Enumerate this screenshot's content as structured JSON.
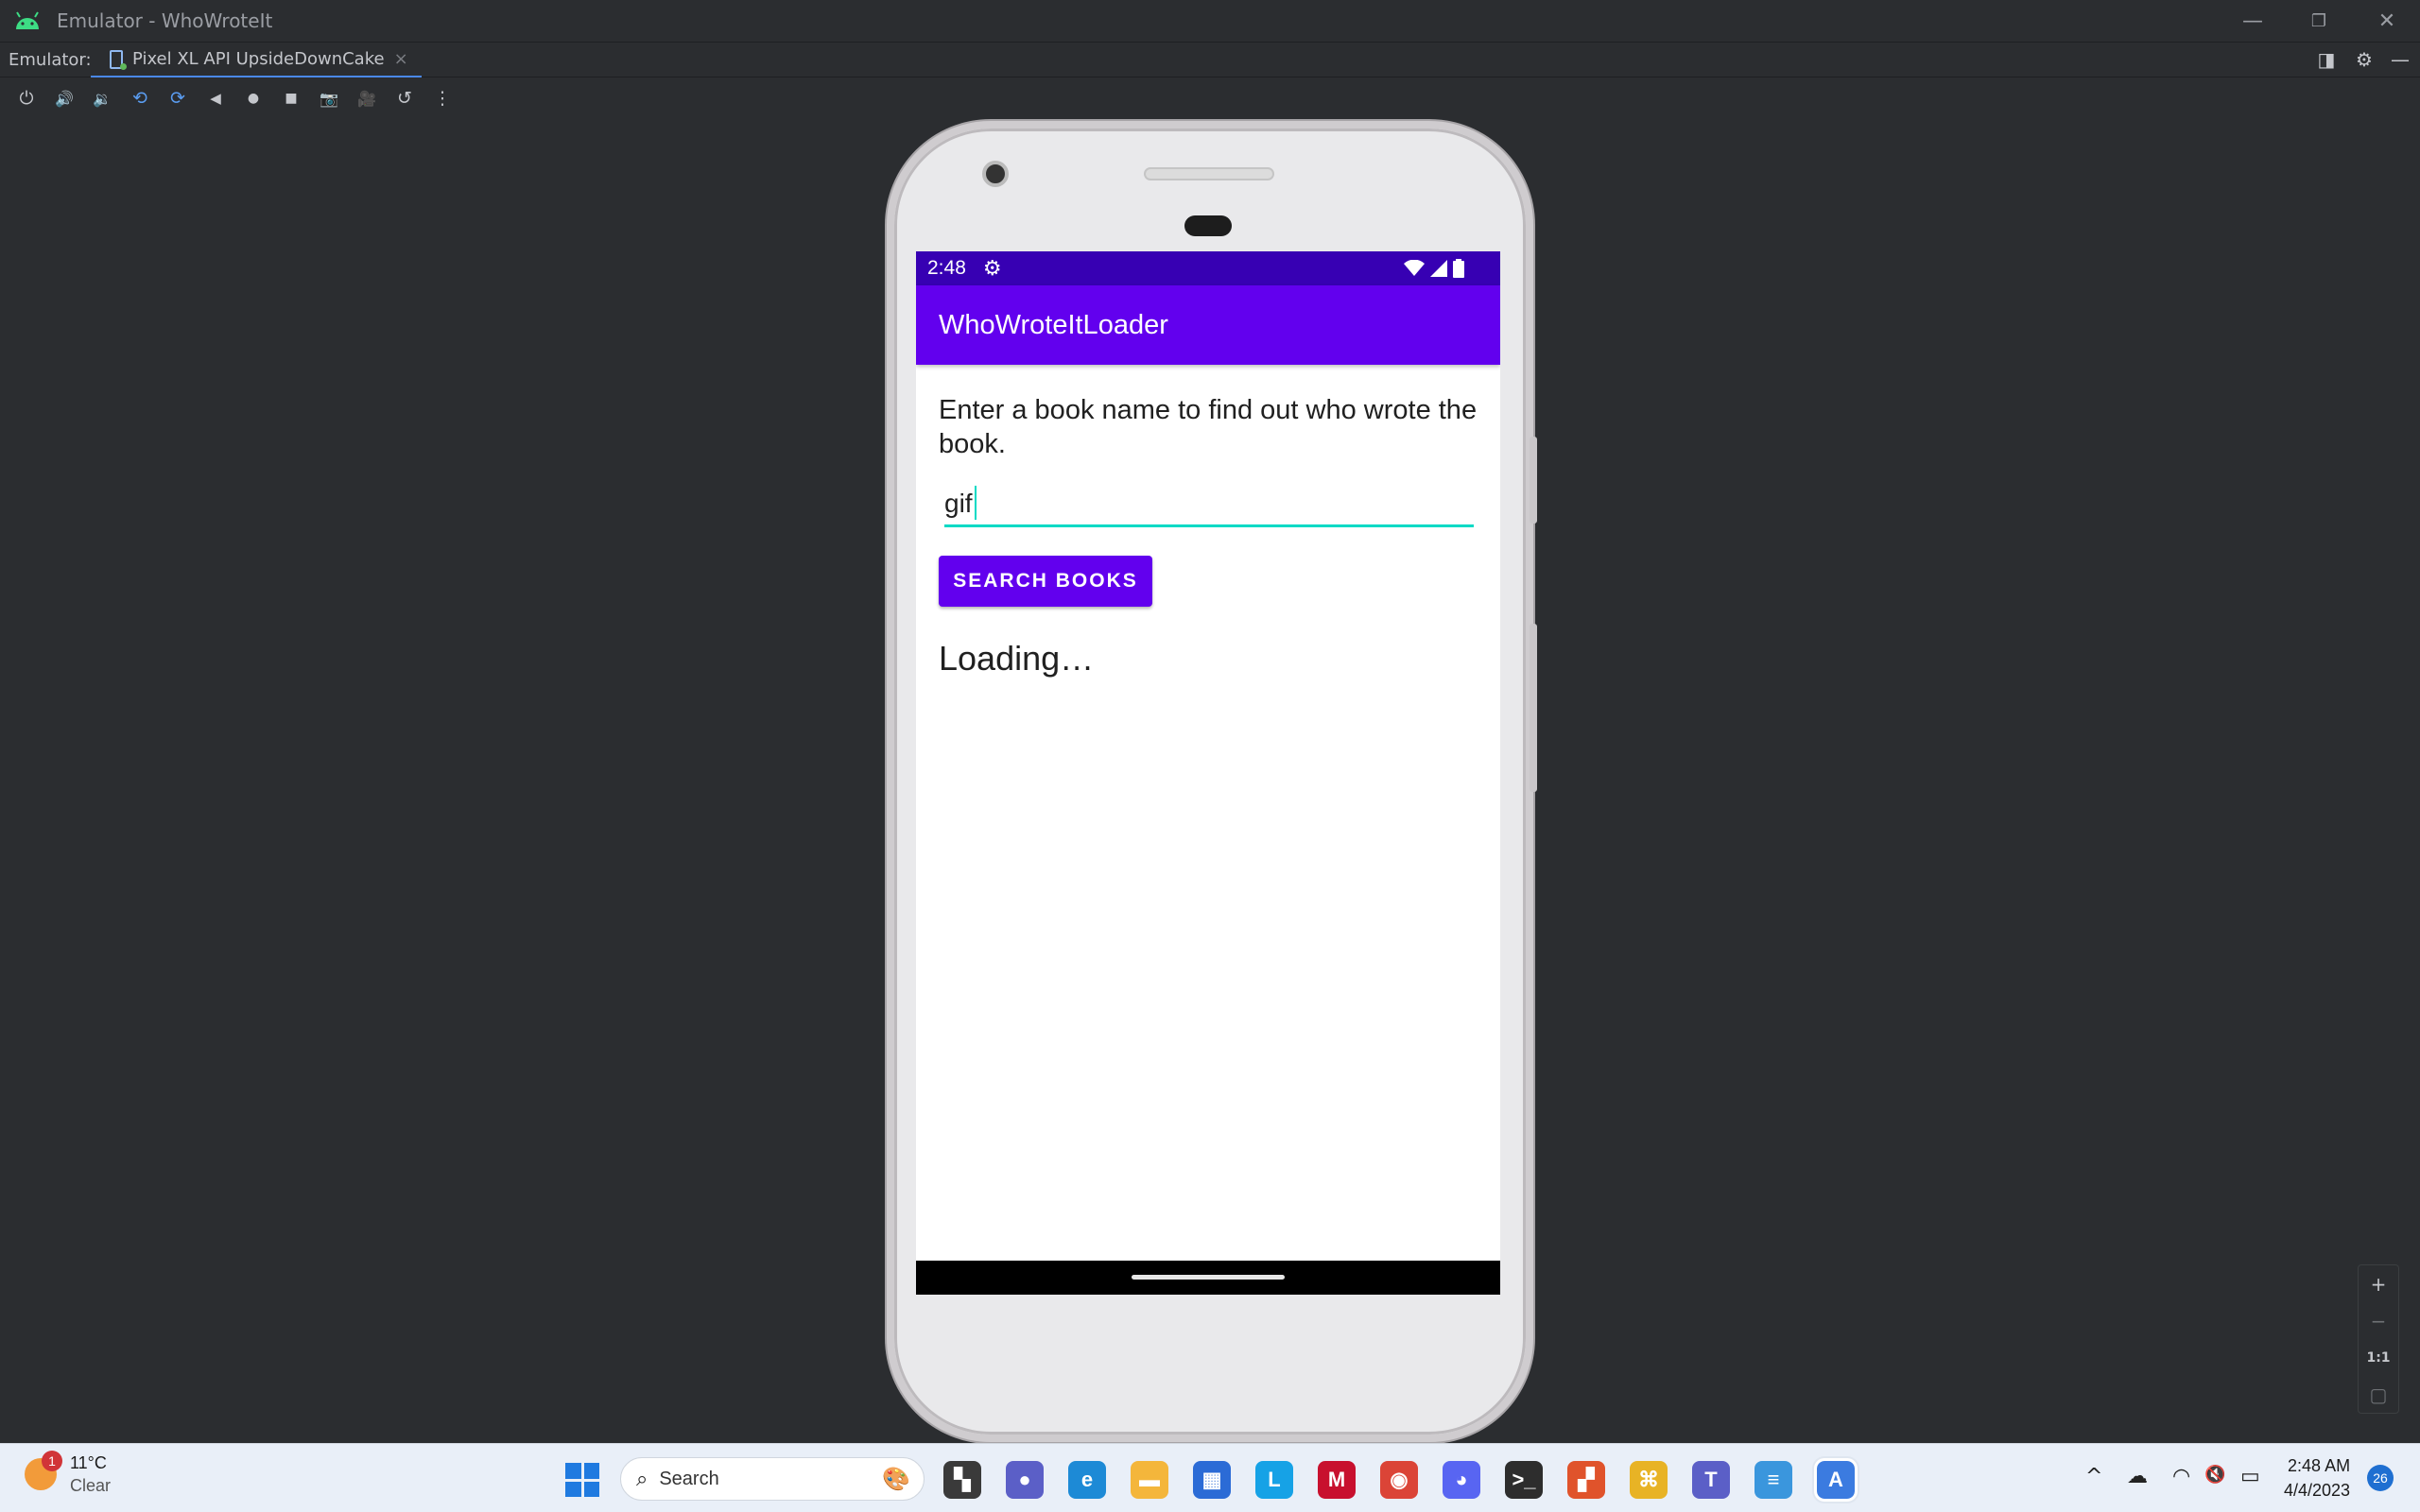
{
  "window": {
    "title": "Emulator - WhoWroteIt",
    "minimize": "—",
    "restore": "❐",
    "close": "✕"
  },
  "tabbar": {
    "label": "Emulator:",
    "active_tab": "Pixel XL API UpsideDownCake",
    "close": "×"
  },
  "toolbar_icons": [
    "power-icon",
    "volume-up-icon",
    "volume-down-icon",
    "rotate-left-icon",
    "rotate-right-icon",
    "back-icon",
    "home-icon",
    "overview-icon",
    "screenshot-icon",
    "screenrecord-icon",
    "snapshot-icon",
    "more-icon"
  ],
  "toolbar_glyphs": {
    "power": "⏻",
    "volume_up": "🔊",
    "volume_down": "🔉",
    "rotate_left": "⟲",
    "rotate_right": "⟳",
    "back": "◀",
    "home": "●",
    "overview": "■",
    "screenshot": "📷",
    "screenrecord": "🎥",
    "snapshot": "↺",
    "more": "⋮"
  },
  "right_tools": {
    "layout": "◨",
    "settings": "⚙",
    "hide": "—"
  },
  "device": {
    "status_time": "2:48",
    "status_gear": "⚙",
    "status_icons": "▼◢▮",
    "app_title": "WhoWroteItLoader",
    "instructions": "Enter a book name to find out who wrote the book.",
    "input_value": "gif",
    "button_label": "SEARCH BOOKS",
    "result_text": "Loading…"
  },
  "zoom": {
    "zoom_in": "+",
    "zoom_out": "−",
    "actual": "1:1",
    "fit": "▢"
  },
  "taskbar": {
    "weather_temp": "11°C",
    "weather_desc": "Clear",
    "weather_badge": "1",
    "search_placeholder": "Search",
    "search_glyph": "⌕",
    "search_deco": "🎨",
    "apps": [
      {
        "name": "file-manager-icon",
        "color": "#3a3a3a",
        "glyph": "▚"
      },
      {
        "name": "chat-icon",
        "color": "#5b5fc7",
        "glyph": "●"
      },
      {
        "name": "edge-icon",
        "color": "#1d8ad6",
        "glyph": "e"
      },
      {
        "name": "folder-icon",
        "color": "#f4b63b",
        "glyph": "▬"
      },
      {
        "name": "store-icon",
        "color": "#2b6bd6",
        "glyph": "▦"
      },
      {
        "name": "l-app-icon",
        "color": "#16a2e6",
        "glyph": "L"
      },
      {
        "name": "mcafee-icon",
        "color": "#c8102e",
        "glyph": "M"
      },
      {
        "name": "chrome-icon",
        "color": "#db4437",
        "glyph": "◉"
      },
      {
        "name": "discord-icon",
        "color": "#5865f2",
        "glyph": "◕"
      },
      {
        "name": "terminal-icon",
        "color": "#2d2d2d",
        "glyph": ">_"
      },
      {
        "name": "office-icon",
        "color": "#e0532b",
        "glyph": "▞"
      },
      {
        "name": "yellow-app-icon",
        "color": "#e8b325",
        "glyph": "⌘"
      },
      {
        "name": "teams-icon",
        "color": "#5b5fc7",
        "glyph": "T"
      },
      {
        "name": "notepad-icon",
        "color": "#3a96dd",
        "glyph": "≡"
      },
      {
        "name": "android-studio-icon",
        "color": "#3b7be0",
        "glyph": "A"
      }
    ],
    "tray": {
      "chevron": "^",
      "onedrive": "☁",
      "wifi": "◠",
      "sound": "🔇",
      "battery": "▭"
    },
    "clock_time": "2:48 AM",
    "clock_date": "4/4/2023",
    "notifications": "26"
  }
}
